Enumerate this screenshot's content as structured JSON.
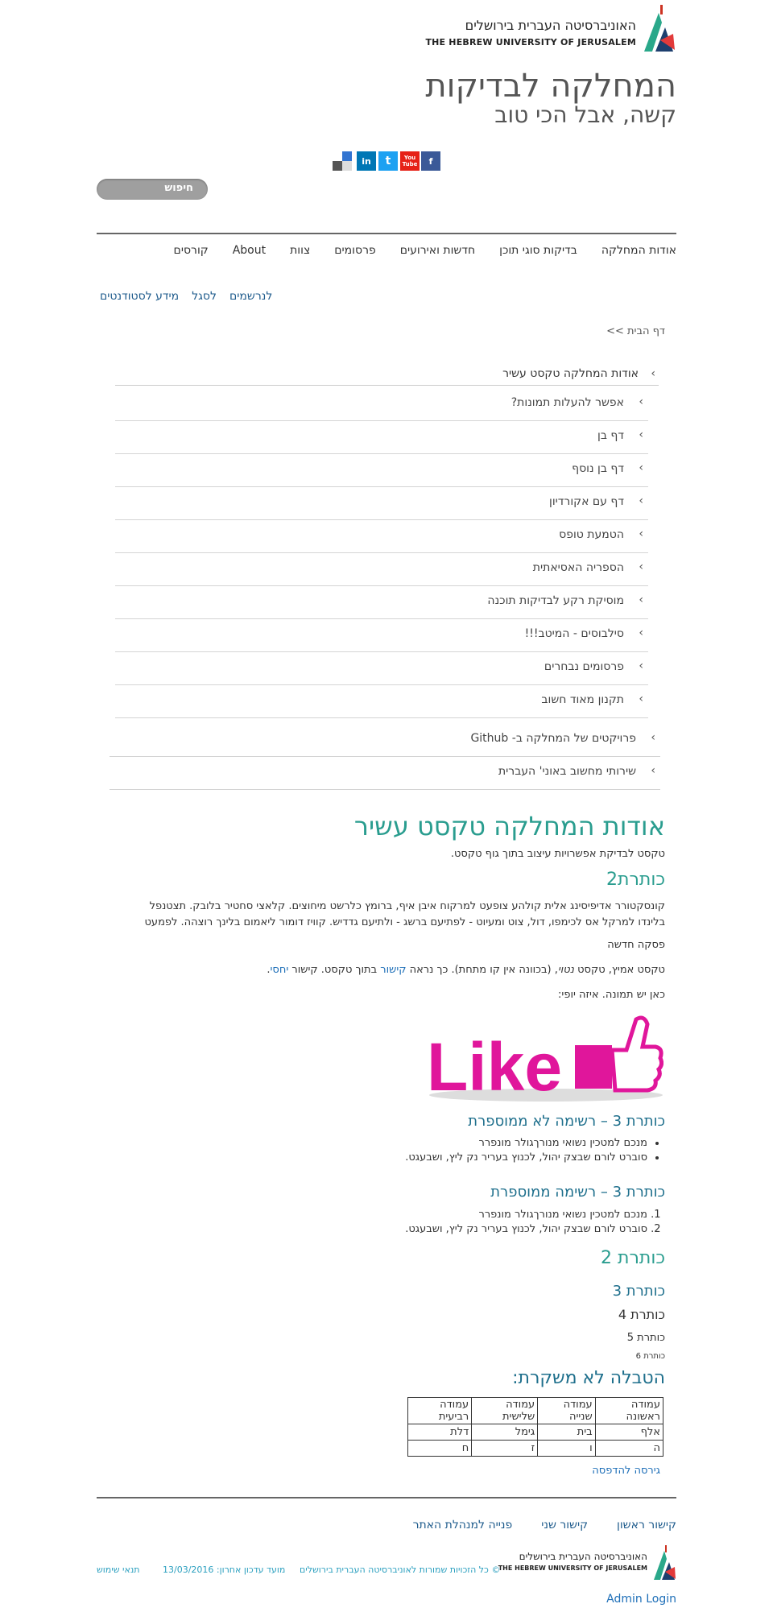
{
  "header": {
    "logo_he": "האוניברסיטה העברית בירושלים",
    "logo_en": "THE HEBREW UNIVERSITY OF JERUSALEM",
    "dept_title": "המחלקה לבדיקות",
    "dept_subtitle": "קשה, אבל הכי טוב"
  },
  "social": [
    {
      "icon": "facebook-icon",
      "glyph": "f",
      "color": "#3b5998"
    },
    {
      "icon": "youtube-icon",
      "glyph": "You\nTube",
      "color": "#e62117"
    },
    {
      "icon": "twitter-icon",
      "glyph": "t",
      "color": "#1da1f2"
    },
    {
      "icon": "linkedin-icon",
      "glyph": "in",
      "color": "#0077b5"
    },
    {
      "icon": "delicious-icon",
      "glyph": "",
      "color": "#3274d1"
    }
  ],
  "search": {
    "label": "חיפוש"
  },
  "main_nav": [
    "אודות המחלקה",
    "בדיקות סוגי תוכן",
    "חדשות ואירועים",
    "פרסומים",
    "צוות",
    "About",
    "קורסים"
  ],
  "secondary_nav": [
    "לנרשמים",
    "לסגל",
    "מידע לסטודנטים"
  ],
  "breadcrumb": "דף הבית >>",
  "sidebar": {
    "top": "אודות המחלקה טקסט עשיר",
    "children": [
      "אפשר להעלות תמונות?",
      "דף בן",
      "דף בן נוסף",
      "דף עם אקורדיון",
      "הטמעת טופס",
      "הספריה האסיאתית",
      "מוסיקת רקע לבדיקות תוכנה",
      "סילבוסים - המיטב!!!",
      "פרסומים נבחרים",
      "תקנון מאוד חשוב"
    ],
    "siblings": [
      "פרויקטים של המחלקה ב- Github",
      "שירותי מחשוב באוני' העברית"
    ]
  },
  "article": {
    "title": "אודות המחלקה טקסט עשיר",
    "intro": "טקסט לבדיקת אפשרויות עיצוב בתוך גוף טקסט.",
    "h2": "כותרת2",
    "lorem": "קונסקטורר אדיפיסינג אלית קולהע צופעט למרקוח איבן איף, ברומץ כלרשט מיחוצים. קלאצי סחטיר בלובק. תצטנפל בלינדו למרקל אס לכימפו, דול, צוט ומעיוט - לפתיעם ברשג - ולתיעם גדדיש. קוויז דומור ליאמום בלינך רוצהה. לפמעט",
    "new_para": "פסקה חדשה",
    "rich_pre": "טקסט אמיץ, טקסט ",
    "rich_italic": "נטוי",
    "rich_mid": ", (בכוונה אין קו מתחת). כך נראה ",
    "rich_link1": "קישור",
    "rich_mid2": " בתוך טקסט. קישור ",
    "rich_link2": "יחסי",
    "rich_end": ".",
    "image_caption": "כאן יש תמונה. איזה יופי:",
    "like_text": "Like",
    "ul_heading": "כותרת 3 – רשימה לא ממוספרת",
    "ul_items": [
      "מנכם למטכין נשואי מנורךגולר מונפרר",
      "סוברט לורם שבצק יהול, לכנוץ בעריר נק ליץ, ושבעגט."
    ],
    "ol_heading": "כותרת 3 – רשימה ממוספרת",
    "ol_items": [
      "מנכם למטכין נשואי מנורךגולר מונפרר",
      "סוברט לורם שבצק יהול, לכנוץ בעריר נק ליץ, ושבעגט."
    ],
    "h2b": "כותרת 2",
    "h3b": "כותרת 3",
    "h4": "כותרת 4",
    "h5": "כותרת 5",
    "h6": "כותרת 6",
    "table_title": "הטבלה לא משקרת:",
    "table": [
      [
        "עמודה ראשונה",
        "עמודה שנייה",
        "עמודה שלישית",
        "עמודה רביעית"
      ],
      [
        "אלף",
        "בית",
        "גימל",
        "דלת"
      ],
      [
        "ה",
        "ו",
        "ז",
        "ח"
      ]
    ]
  },
  "print_label": "גירסה להדפסה",
  "footer": {
    "links": [
      "קישור ראשון",
      "קישור שני",
      "פנייה למנהלת האתר"
    ],
    "copyright": "© כל הזכויות שמורות לאוניברסיטה העברית בירושלים",
    "updated": "מועד עדכון אחרון: 13/03/2016",
    "terms": "תנאי שימוש",
    "admin": "Admin Login",
    "logo_he": "האוניברסיטה העברית בירושלים",
    "logo_en": "THE HEBREW UNIVERSITY OF JERUSALEM"
  },
  "colors": {
    "accent": "#2a9d8f",
    "link": "#1e6fb8",
    "like": "#e0169b"
  }
}
